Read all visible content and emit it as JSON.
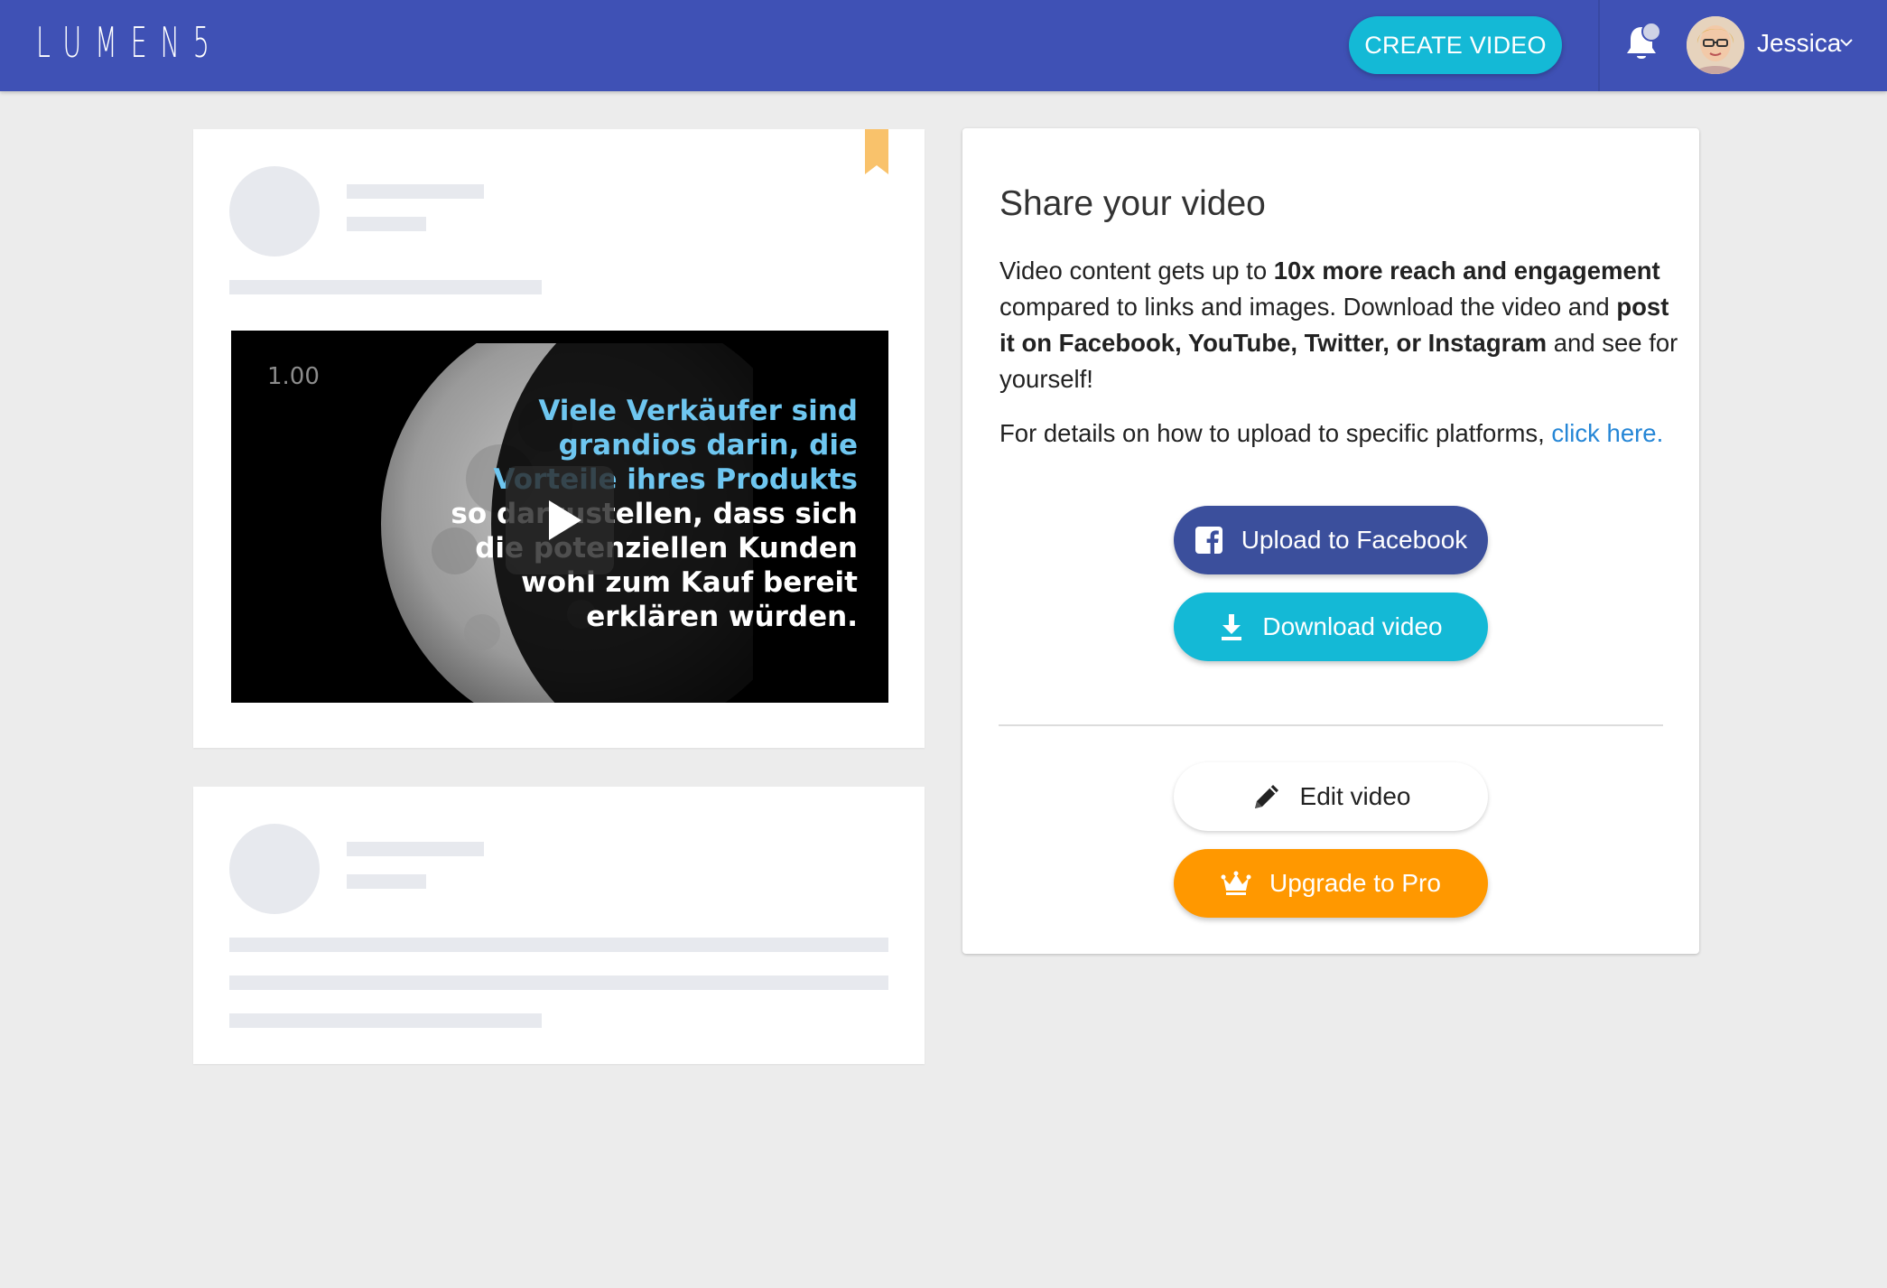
{
  "header": {
    "logo": "LUMEN5",
    "create_label": "CREATE VIDEO",
    "username": "Jessica",
    "icons": [
      "bell-icon",
      "chevron-down-icon"
    ]
  },
  "video": {
    "time": "1.00",
    "caption_lines": [
      "Viele Verkäufer sind",
      "grandios darin, die",
      "Vorteile ihres Produkts",
      "so darzustellen, dass sich",
      "die potenziellen Kunden",
      "wohl zum Kauf bereit",
      "erklären würden."
    ]
  },
  "share": {
    "title": "Share your video",
    "desc_1": "Video content gets up to ",
    "desc_bold_1": "10x more reach and engagement",
    "desc_2": " compared to links and images. Download the video and ",
    "desc_bold_2": "post it on Facebook, YouTube, Twitter, or Instagram",
    "desc_3": " and see for yourself!",
    "details_text": "For details on how to upload to specific platforms, ",
    "details_link": "click here.",
    "buttons": {
      "facebook": "Upload to Facebook",
      "download": "Download video",
      "edit": "Edit video",
      "pro": "Upgrade to Pro"
    }
  },
  "colors": {
    "header_bg": "#3f51b5",
    "accent_cyan": "#14b9d6",
    "facebook_blue": "#3b4f9c",
    "pro_orange": "#ff9800",
    "link_blue": "#2586d6",
    "bookmark": "#f9c26b"
  }
}
